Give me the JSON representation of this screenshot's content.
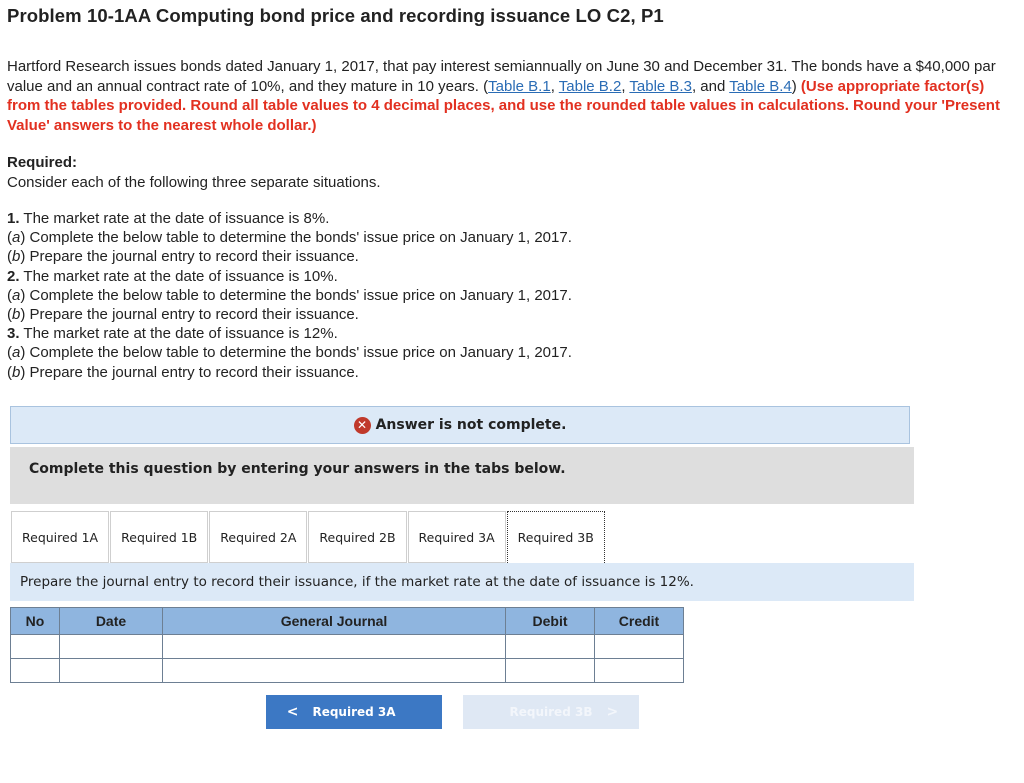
{
  "title": "Problem 10-1AA Computing bond price and recording issuance LO C2, P1",
  "intro": {
    "text": "Hartford Research issues bonds dated January 1, 2017, that pay interest semiannually on June 30 and December 31. The bonds have a $40,000 par value and an annual contract rate of 10%, and they mature in 10 years. (",
    "link1": "Table B.1",
    "sep1": ", ",
    "link2": "Table B.2",
    "sep2": ", ",
    "link3": "Table B.3",
    "sep3": ", and ",
    "link4": "Table B.4",
    "close": ") ",
    "red_note": "(Use appropriate factor(s) from the tables provided. Round all table values to 4 decimal places, and use the rounded table values in calculations. Round your 'Present Value' answers to the nearest whole dollar.)"
  },
  "required": {
    "heading": "Required:",
    "text": "Consider each of the following three separate situations."
  },
  "situations": [
    {
      "num": "1.",
      "text": " The market rate at the date of issuance is 8%.",
      "a_label": "a",
      "a_text": " Complete the below table to determine the bonds' issue price on January 1, 2017.",
      "b_label": "b",
      "b_text": " Prepare the journal entry to record their issuance."
    },
    {
      "num": "2.",
      "text": " The market rate at the date of issuance is 10%.",
      "a_label": "a",
      "a_text": " Complete the below table to determine the bonds' issue price on January 1, 2017.",
      "b_label": "b",
      "b_text": " Prepare the journal entry to record their issuance."
    },
    {
      "num": "3.",
      "text": " The market rate at the date of issuance is 12%.",
      "a_label": "a",
      "a_text": " Complete the below table to determine the bonds' issue price on January 1, 2017.",
      "b_label": "b",
      "b_text": " Prepare the journal entry to record their issuance."
    }
  ],
  "answer_status": {
    "icon": "close-icon",
    "text": "Answer is not complete."
  },
  "complete_prompt": "Complete this question by entering your answers in the tabs below.",
  "tabs": [
    {
      "label": "Required 1A"
    },
    {
      "label": "Required 1B"
    },
    {
      "label": "Required 2A"
    },
    {
      "label": "Required 2B"
    },
    {
      "label": "Required 3A"
    },
    {
      "label": "Required 3B",
      "active": true
    }
  ],
  "instruction": "Prepare the journal entry to record their issuance, if the market rate at the date of issuance is 12%.",
  "journal": {
    "headers": [
      "No",
      "Date",
      "General Journal",
      "Debit",
      "Credit"
    ],
    "rows": [
      [
        "",
        "",
        "",
        "",
        ""
      ],
      [
        "",
        "",
        "",
        "",
        ""
      ]
    ]
  },
  "nav": {
    "prev_label": "Required 3A",
    "next_label": "Required 3B"
  },
  "colors": {
    "accent_blue": "#3c78c4",
    "header_blue": "#8fb5df",
    "banner_blue": "#dce9f7",
    "error_red": "#c0392b",
    "note_red": "#e23020"
  }
}
